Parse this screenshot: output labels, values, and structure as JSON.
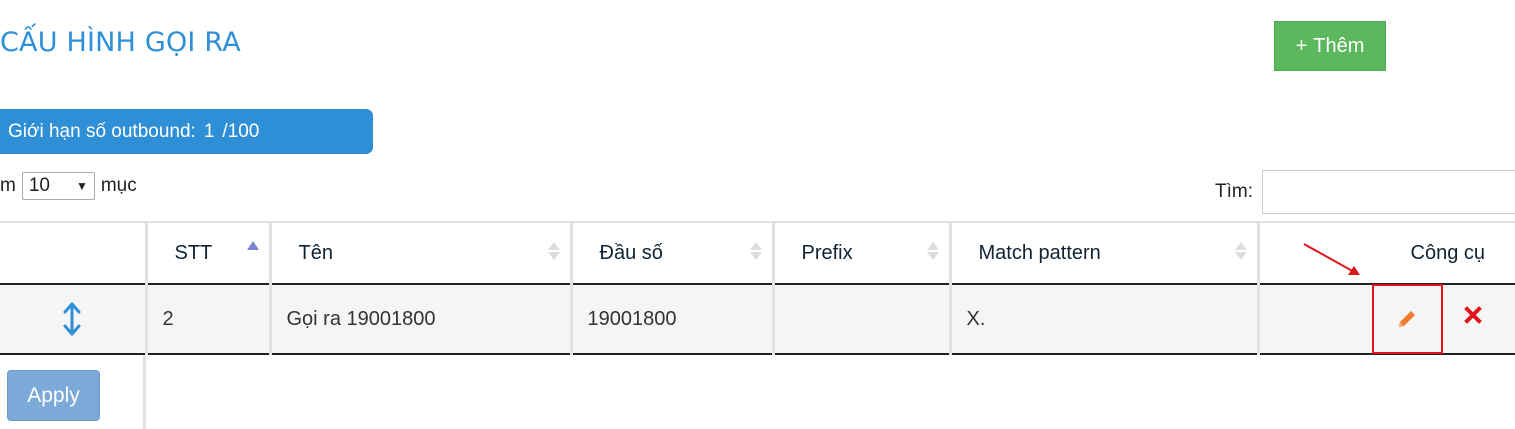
{
  "page": {
    "title": "CẤU HÌNH GỌI RA"
  },
  "actions": {
    "add_label": "Thêm",
    "add_icon": "plus-icon",
    "apply_label": "Apply"
  },
  "limit": {
    "label": "Giới hạn số outbound:",
    "value": "1",
    "max": "/100"
  },
  "length_menu": {
    "prefix": "m",
    "selected": "10",
    "suffix": "mục"
  },
  "search": {
    "label": "Tìm:",
    "value": "",
    "placeholder": ""
  },
  "table": {
    "columns": [
      "",
      "STT",
      "Tên",
      "Đầu số",
      "Prefix",
      "Match pattern",
      "Công cụ"
    ],
    "rows": [
      {
        "stt": "2",
        "name": "Gọi ra 19001800",
        "number": "19001800",
        "prefix": "",
        "pattern": "X.",
        "tools": [
          "edit-icon",
          "delete-icon"
        ]
      }
    ]
  },
  "colors": {
    "title": "#2e8fd6",
    "add_button": "#5cb85c",
    "badge": "#2e8fd6",
    "highlight": "#e0141a",
    "edit_icon": "#ef7b2b",
    "delete_icon": "#e0141a",
    "apply_button": "#7ba9d8"
  }
}
